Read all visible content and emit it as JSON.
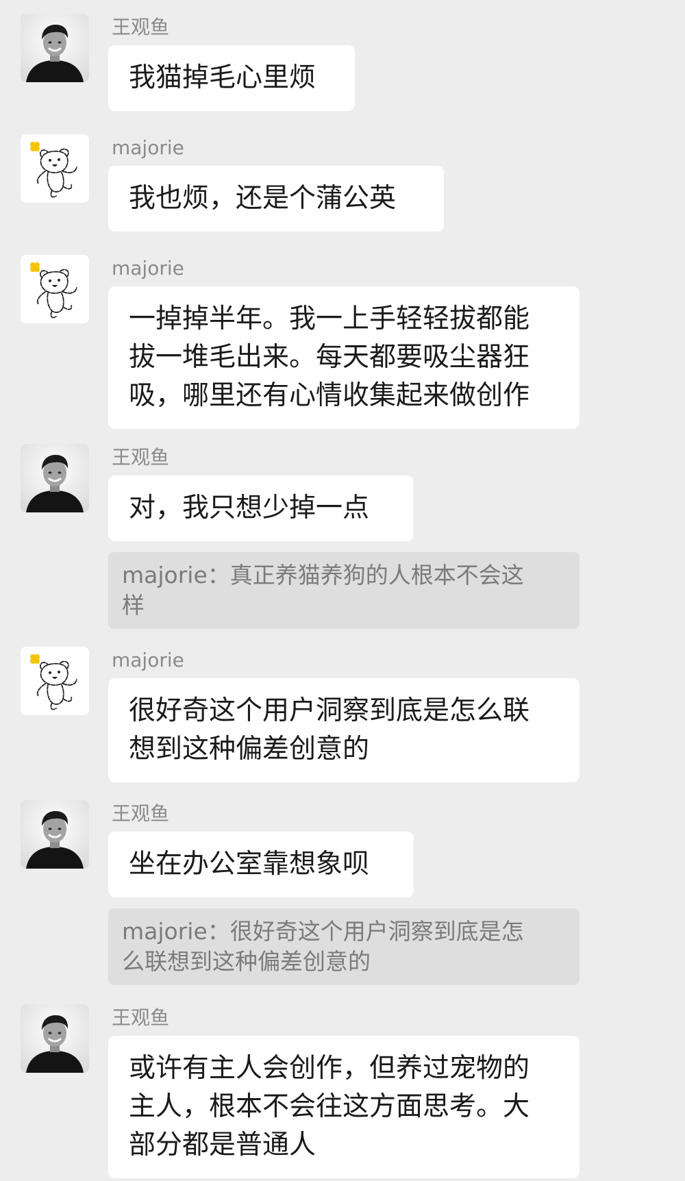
{
  "messages": [
    {
      "sender": "王观鱼",
      "avatar": "man-avatar-icon",
      "lines": [
        "我猫掉毛心里烦"
      ]
    },
    {
      "sender": "majorie",
      "avatar": "bear-avatar-icon",
      "lines": [
        "我也烦，还是个蒲公英"
      ]
    },
    {
      "sender": "majorie",
      "avatar": "bear-avatar-icon",
      "lines": [
        "一掉掉半年。我一上手轻轻拔都能",
        "拔一堆毛出来。每天都要吸尘器狂",
        "吸，哪里还有心情收集起来做创作"
      ]
    },
    {
      "sender": "王观鱼",
      "avatar": "man-avatar-icon",
      "lines": [
        "对，我只想少掉一点"
      ],
      "quote": [
        "majorie：真正养猫养狗的人根本不会这",
        "样"
      ]
    },
    {
      "sender": "majorie",
      "avatar": "bear-avatar-icon",
      "lines": [
        "很好奇这个用户洞察到底是怎么联",
        "想到这种偏差创意的"
      ]
    },
    {
      "sender": "王观鱼",
      "avatar": "man-avatar-icon",
      "lines": [
        "坐在办公室靠想象呗"
      ],
      "quote": [
        "majorie：很好奇这个用户洞察到底是怎",
        "么联想到这种偏差创意的"
      ]
    },
    {
      "sender": "王观鱼",
      "avatar": "man-avatar-icon",
      "lines": [
        "或许有主人会创作，但养过宠物的",
        "主人，根本不会往这方面思考。大",
        "部分都是普通人"
      ]
    }
  ],
  "colors": {
    "background": "#ededed",
    "bubble": "#ffffff",
    "quote": "#dedede",
    "sender_name": "#8a8a8a",
    "message_text": "#1a1a1a",
    "quote_text": "#7b7b7b",
    "bear_flower": "#f5c400"
  }
}
